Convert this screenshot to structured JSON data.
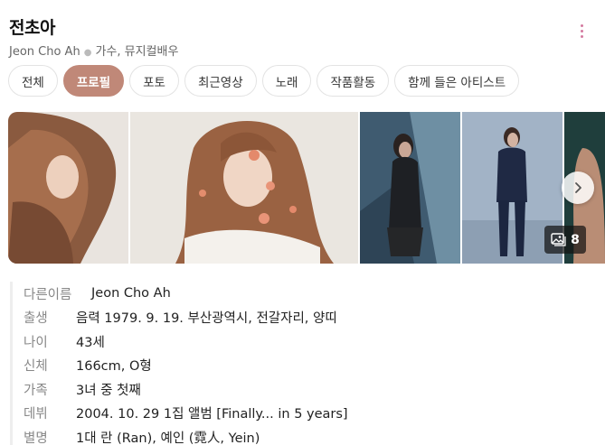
{
  "header": {
    "title": "전초아",
    "name_en": "Jeon Cho Ah",
    "occupation": "가수, 뮤지컬배우"
  },
  "tabs": [
    {
      "label": "전체",
      "active": false
    },
    {
      "label": "프로필",
      "active": true
    },
    {
      "label": "포토",
      "active": false
    },
    {
      "label": "최근영상",
      "active": false
    },
    {
      "label": "노래",
      "active": false
    },
    {
      "label": "작품활동",
      "active": false
    },
    {
      "label": "함께 들은 아티스트",
      "active": false
    }
  ],
  "gallery": {
    "photo_count": "8",
    "icons": [
      "image-stack-icon",
      "chevron-right-icon"
    ]
  },
  "profile": [
    {
      "key": "다른이름",
      "value": "Jeon Cho Ah"
    },
    {
      "key": "출생",
      "value": "음력 1979. 9. 19. 부산광역시, 전갈자리, 양띠"
    },
    {
      "key": "나이",
      "value": "43세"
    },
    {
      "key": "신체",
      "value": "166cm, O형"
    },
    {
      "key": "가족",
      "value": "3녀 중 첫째"
    },
    {
      "key": "데뷔",
      "value": "2004. 10. 29 1집 앨범 [Finally... in 5 years]"
    },
    {
      "key": "별명",
      "value": "1대 란 (Ran), 예인 (霓人, Yein)"
    }
  ],
  "colors": {
    "accent": "#c08878",
    "more_dots": "#d47aa0"
  }
}
